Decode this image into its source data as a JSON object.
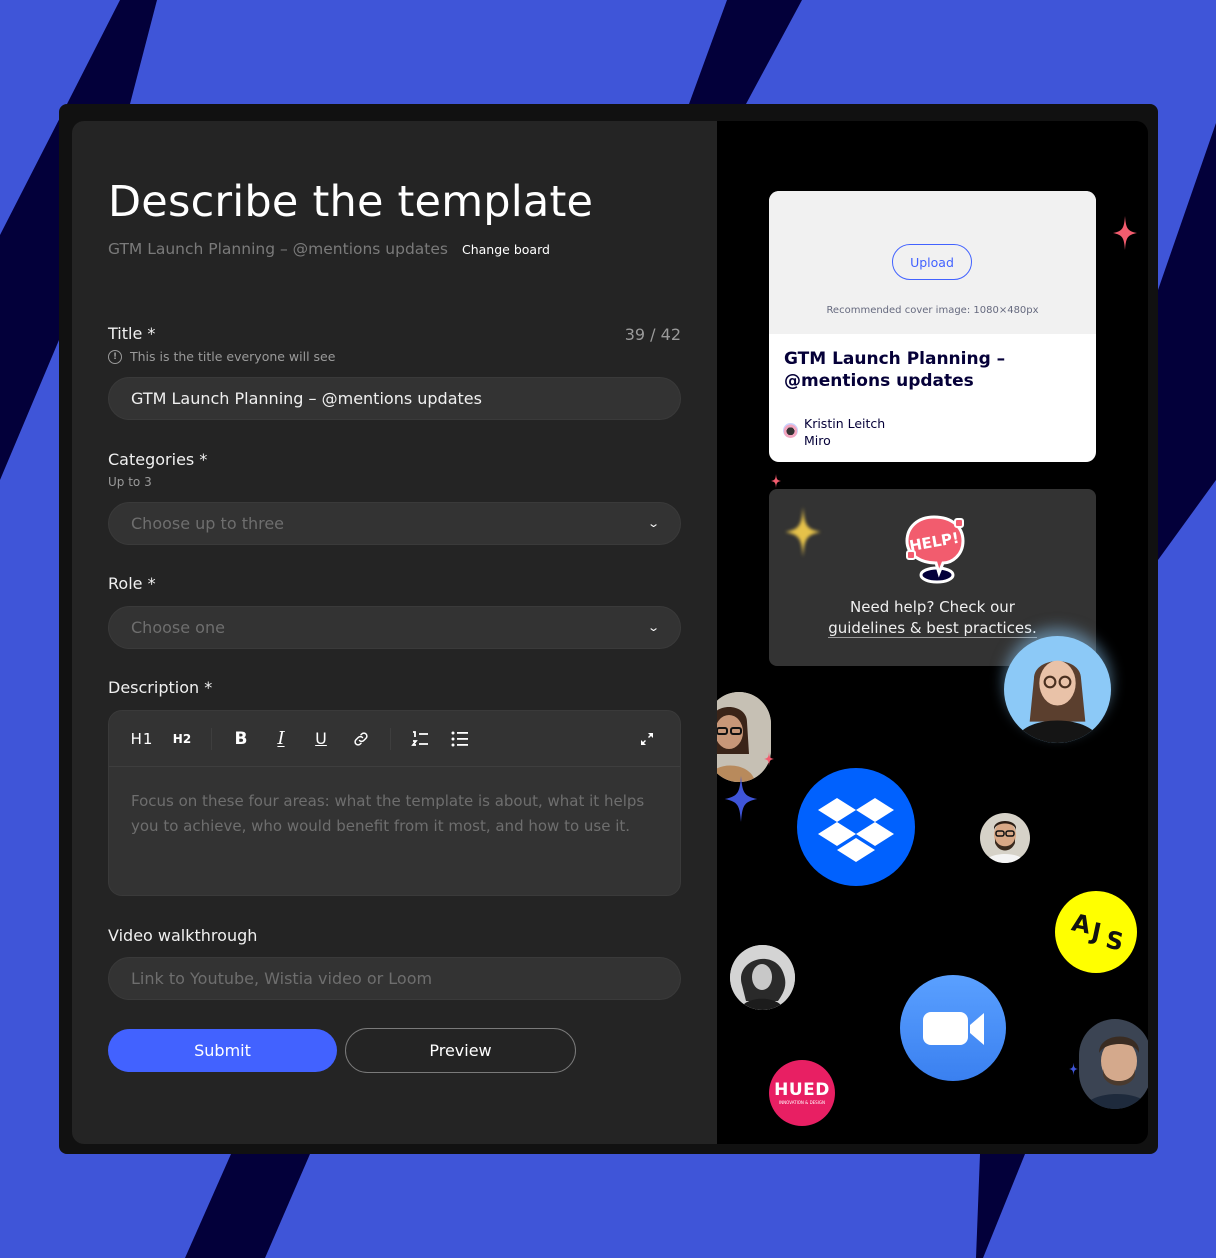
{
  "colors": {
    "background_blue": "#3f55d8",
    "stripe_navy": "#03003a",
    "accent": "#4262ff",
    "panel": "#242424",
    "field": "#333333",
    "help_red": "#f25c6e",
    "dropbox_blue": "#0061fe",
    "zoom_blue": "#4a8cff",
    "ajs_yellow": "#ffff00",
    "hued_pink": "#e81f63"
  },
  "header": {
    "title": "Describe the template",
    "board_name": "GTM Launch Planning – @mentions updates",
    "change_board": "Change board"
  },
  "form": {
    "title": {
      "label": "Title *",
      "hint": "This is the title everyone will see",
      "hint_icon": "info-circle-icon",
      "counter": "39 / 42",
      "value": "GTM Launch Planning – @mentions updates"
    },
    "categories": {
      "label": "Categories *",
      "hint": "Up to 3",
      "placeholder": "Choose up to three",
      "chevron": "⌄"
    },
    "role": {
      "label": "Role *",
      "placeholder": "Choose one",
      "chevron": "⌄"
    },
    "description": {
      "label": "Description *",
      "toolbar": {
        "h1": "H1",
        "h2": "H2",
        "bold": "B",
        "italic": "I",
        "underline": "U",
        "link": "link-icon",
        "ordered_list": "ordered-list-icon",
        "bullet_list": "bullet-list-icon",
        "expand": "expand-icon"
      },
      "placeholder": "Focus on these four areas: what the template is about, what it helps you to achieve, who would benefit from it most, and how to use it."
    },
    "video": {
      "label": "Video walkthrough",
      "placeholder": "Link to Youtube, Wistia video or Loom"
    },
    "submit_label": "Submit",
    "preview_label": "Preview"
  },
  "preview_card": {
    "upload_label": "Upload",
    "recommendation": "Recommended cover image: 1080×480px",
    "title": "GTM Launch Planning – @mentions updates",
    "author_name": "Kristin Leitch",
    "author_org": "Miro"
  },
  "help": {
    "sticker_text": "HELP!",
    "line1": "Need help? Check our",
    "link": "guidelines & best practices."
  },
  "decor": {
    "ajs_label_a": "A",
    "ajs_label_j": "J",
    "ajs_label_s": "S",
    "hued_label": "HUED",
    "hued_sub": "INNOVATION & DESIGN"
  }
}
